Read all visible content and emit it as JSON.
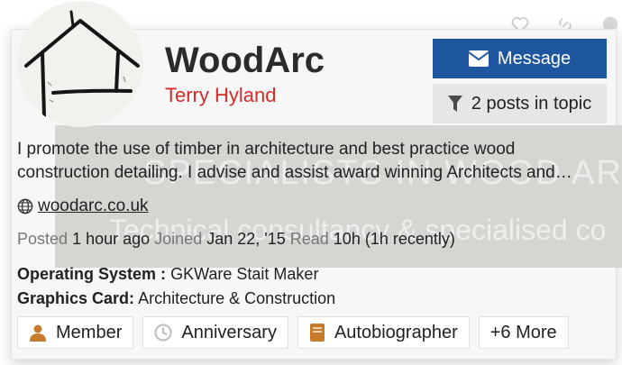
{
  "user": {
    "username": "WoodArc",
    "full_name": "Terry Hyland",
    "bio_line1": "I promote the use of timber in architecture and best practice wood",
    "bio_line2": "construction detailing. I advise and assist award winning Architects and…",
    "website": "woodarc.co.uk"
  },
  "actions": {
    "message_label": "Message",
    "posts_label": "2 posts in topic"
  },
  "banner": {
    "line1": "SPECIALISTS IN WOOD ARCHITECTURE",
    "line2": "Technical consultancy & specialised co"
  },
  "stats": {
    "posted_label": "Posted",
    "posted_value": "1 hour ago",
    "joined_label": "Joined",
    "joined_value": "Jan 22, '15",
    "read_label": "Read",
    "read_value": "10h (1h recently)"
  },
  "fields": [
    {
      "label": "Operating System :",
      "value": "GKWare Stait Maker"
    },
    {
      "label": "Graphics Card:",
      "value": "Architecture & Construction"
    }
  ],
  "badges": [
    {
      "label": "Member",
      "icon": "user-icon",
      "color": "#c67a2c"
    },
    {
      "label": "Anniversary",
      "icon": "clock-icon",
      "color": "#bdbdbd"
    },
    {
      "label": "Autobiographer",
      "icon": "book-icon",
      "color": "#c67a2c"
    },
    {
      "label": "+6 More"
    }
  ],
  "colors": {
    "accent": "#1e56a0",
    "name_red": "#d42b2b",
    "badge_bronze": "#c67a2c"
  }
}
